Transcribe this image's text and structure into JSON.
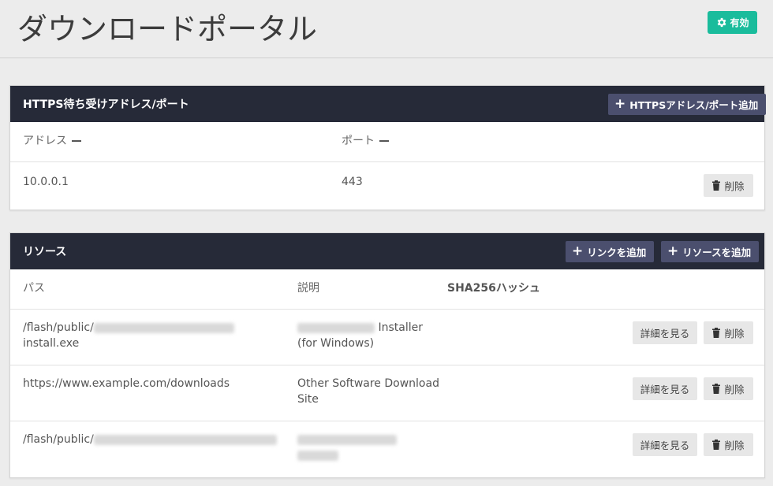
{
  "page": {
    "title": "ダウンロードポータル",
    "status_label": "有効",
    "accent_color": "#1abc9c"
  },
  "https_panel": {
    "title": "HTTPS待ち受けアドレス/ポート",
    "add_button": "HTTPSアドレス/ポート追加",
    "columns": [
      "アドレス",
      "ポート"
    ],
    "rows": [
      {
        "address": "10.0.0.1",
        "port": "443",
        "delete_label": "削除"
      }
    ]
  },
  "resources_panel": {
    "title": "リソース",
    "add_link_button": "リンクを追加",
    "add_resource_button": "リソースを追加",
    "columns": [
      "パス",
      "説明",
      "SHA256ハッシュ"
    ],
    "rows": [
      {
        "path_line1": "/flash/public/",
        "path_line2": "install.exe",
        "desc_line1": "Installer",
        "desc_line2": "(for Windows)",
        "details_label": "詳細を見る",
        "delete_label": "削除"
      },
      {
        "path_line1": "https://www.example.com/downloads",
        "desc_line1": "Other Software Download",
        "desc_line2": "Site",
        "details_label": "詳細を見る",
        "delete_label": "削除"
      },
      {
        "path_line1": "/flash/public/",
        "details_label": "詳細を見る",
        "delete_label": "削除"
      }
    ]
  }
}
